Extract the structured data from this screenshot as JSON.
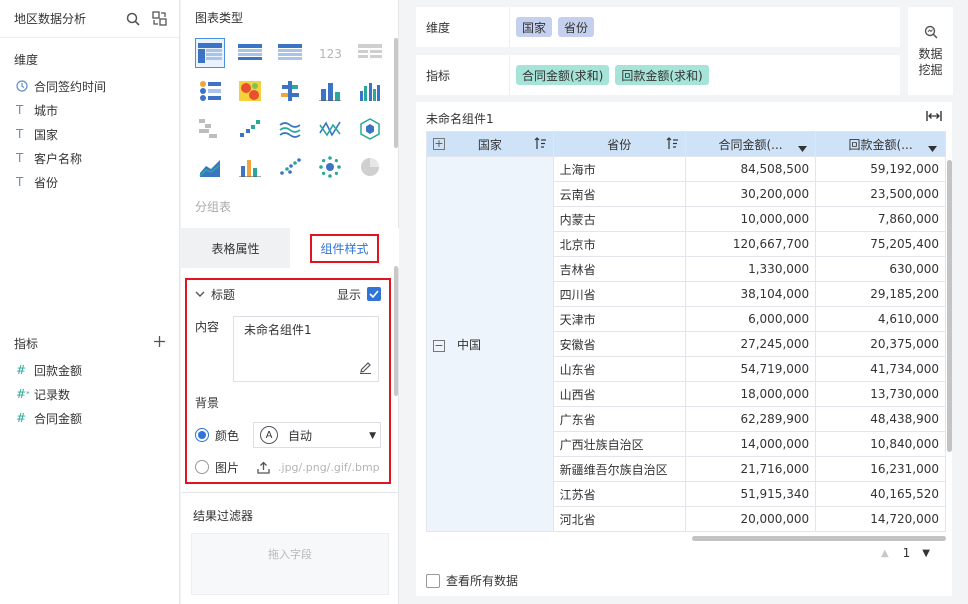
{
  "left_panel": {
    "title": "地区数据分析",
    "dimensions_header": "维度",
    "dimensions": [
      {
        "label": "合同签约时间",
        "icon": "clock-icon"
      },
      {
        "label": "城市",
        "icon": "text-field-icon"
      },
      {
        "label": "国家",
        "icon": "text-field-icon"
      },
      {
        "label": "客户名称",
        "icon": "text-field-icon"
      },
      {
        "label": "省份",
        "icon": "text-field-icon"
      }
    ],
    "measures_header": "指标",
    "measures": [
      {
        "label": "回款金额",
        "icon": "hash-icon"
      },
      {
        "label": "记录数",
        "icon": "hash-star-icon"
      },
      {
        "label": "合同金额",
        "icon": "hash-icon"
      }
    ]
  },
  "middle_panel": {
    "chart_types_title": "图表类型",
    "group_table_label": "分组表",
    "tabs": [
      {
        "label": "表格属性",
        "active": false
      },
      {
        "label": "组件样式",
        "active": true
      }
    ],
    "title_section": {
      "label": "标题",
      "show_label": "显示",
      "show_checked": true,
      "content_label": "内容",
      "content_value": "未命名组件1",
      "background_label": "背景",
      "color_option_label": "颜色",
      "color_selected": true,
      "color_select_value": "自动",
      "auto_icon_letter": "A",
      "image_option_label": "图片",
      "image_placeholder": ".jpg/.png/.gif/.bmp"
    },
    "result_filter_title": "结果过滤器",
    "drop_hint": "拖入字段"
  },
  "shelves": {
    "dimension_label": "维度",
    "dimension_pills": [
      "国家",
      "省份"
    ],
    "measure_label": "指标",
    "measure_pills": [
      "合同金额(求和)",
      "回款金额(求和)"
    ]
  },
  "data_mining": {
    "label": "数据挖掘"
  },
  "widget": {
    "title": "未命名组件1",
    "columns": [
      "国家",
      "省份",
      "合同金额(...",
      "回款金额(..."
    ],
    "country": "中国",
    "rows": [
      {
        "province": "上海市",
        "contract": "84,508,500",
        "payment": "59,192,000"
      },
      {
        "province": "云南省",
        "contract": "30,200,000",
        "payment": "23,500,000"
      },
      {
        "province": "内蒙古",
        "contract": "10,000,000",
        "payment": "7,860,000"
      },
      {
        "province": "北京市",
        "contract": "120,667,700",
        "payment": "75,205,400"
      },
      {
        "province": "吉林省",
        "contract": "1,330,000",
        "payment": "630,000"
      },
      {
        "province": "四川省",
        "contract": "38,104,000",
        "payment": "29,185,200"
      },
      {
        "province": "天津市",
        "contract": "6,000,000",
        "payment": "4,610,000"
      },
      {
        "province": "安徽省",
        "contract": "27,245,000",
        "payment": "20,375,000"
      },
      {
        "province": "山东省",
        "contract": "54,719,000",
        "payment": "41,734,000"
      },
      {
        "province": "山西省",
        "contract": "18,000,000",
        "payment": "13,730,000"
      },
      {
        "province": "广东省",
        "contract": "62,289,900",
        "payment": "48,438,900"
      },
      {
        "province": "广西壮族自治区",
        "contract": "14,000,000",
        "payment": "10,840,000"
      },
      {
        "province": "新疆维吾尔族自治区",
        "contract": "21,716,000",
        "payment": "16,231,000"
      },
      {
        "province": "江苏省",
        "contract": "51,915,340",
        "payment": "40,165,520"
      },
      {
        "province": "河北省",
        "contract": "20,000,000",
        "payment": "14,720,000"
      }
    ],
    "page_number": "1",
    "view_all_label": "查看所有数据"
  }
}
